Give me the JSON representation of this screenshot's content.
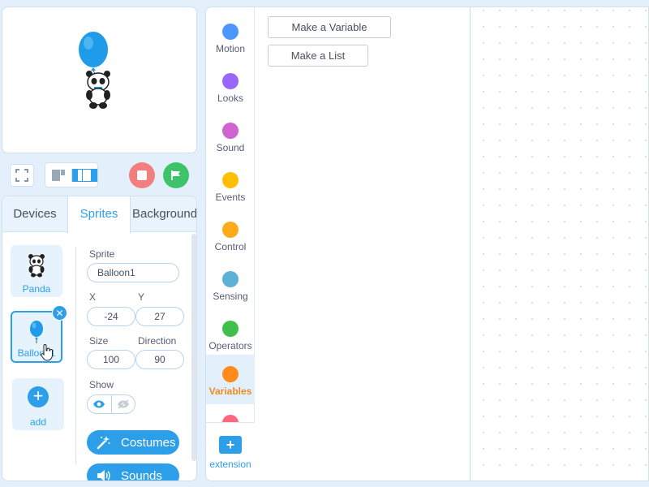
{
  "stage": {
    "sprites": [
      "balloon-panda-icon"
    ]
  },
  "stage_controls": {
    "fullscreen_icon": "fullscreen-icon",
    "layout_small_icon": "small-stage-icon",
    "layout_large_icon": "large-stage-icon",
    "stop_icon": "stop-icon",
    "go_icon": "green-flag-icon",
    "colors": {
      "stop": "#f37e7e",
      "go": "#3dc36a",
      "accent": "#2d9fe9"
    }
  },
  "tabs": [
    {
      "label": "Devices",
      "active": false
    },
    {
      "label": "Sprites",
      "active": true
    },
    {
      "label": "Background",
      "active": false
    }
  ],
  "sprite_list": {
    "items": [
      {
        "label": "Panda",
        "icon": "panda-icon",
        "selected": false
      },
      {
        "label": "Balloon1",
        "icon": "balloon-icon",
        "selected": true
      }
    ],
    "add_label": "add"
  },
  "sprite_info": {
    "sprite_label": "Sprite",
    "sprite_name": "Balloon1",
    "x_label": "X",
    "x_value": "-24",
    "y_label": "Y",
    "y_value": "27",
    "size_label": "Size",
    "size_value": "100",
    "direction_label": "Direction",
    "direction_value": "90",
    "show_label": "Show",
    "costumes_label": "Costumes",
    "sounds_label": "Sounds"
  },
  "categories": [
    {
      "name": "Motion",
      "color": "#4c97ff"
    },
    {
      "name": "Looks",
      "color": "#9966ff"
    },
    {
      "name": "Sound",
      "color": "#cf63cf"
    },
    {
      "name": "Events",
      "color": "#ffbf00"
    },
    {
      "name": "Control",
      "color": "#ffab19"
    },
    {
      "name": "Sensing",
      "color": "#5cb1d6"
    },
    {
      "name": "Operators",
      "color": "#40bf4a"
    },
    {
      "name": "Variables",
      "color": "#ff8c1a",
      "active": true
    }
  ],
  "extension_label": "extension",
  "flyout": {
    "make_variable": "Make a Variable",
    "make_list": "Make a List"
  }
}
